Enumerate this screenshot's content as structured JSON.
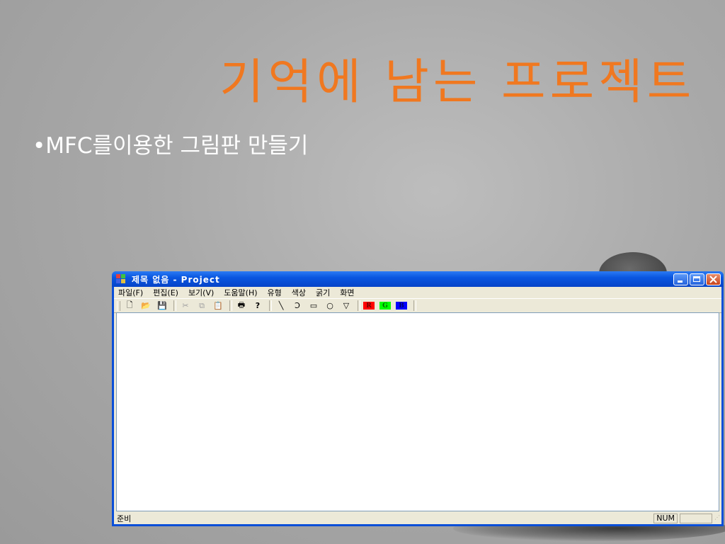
{
  "slide": {
    "title": "기억에 남는 프로젝트",
    "bullet": "•MFC를이용한 그림판 만들기"
  },
  "window": {
    "title": "제목 없음 - Project",
    "controls": {
      "minimize": "_",
      "maximize": "□",
      "close": "×"
    }
  },
  "menu": {
    "items": [
      "파일(F)",
      "편집(E)",
      "보기(V)",
      "도움말(H)",
      "유형",
      "색상",
      "굵기",
      "화면"
    ]
  },
  "toolbar": {
    "buttons": [
      {
        "name": "new-icon",
        "glyph": "🗋"
      },
      {
        "name": "open-icon",
        "glyph": "📂"
      },
      {
        "name": "save-icon",
        "glyph": "💾"
      },
      {
        "name": "cut-icon",
        "glyph": "✂"
      },
      {
        "name": "copy-icon",
        "glyph": "⧉"
      },
      {
        "name": "paste-icon",
        "glyph": "📋"
      },
      {
        "name": "print-icon",
        "glyph": "🖶"
      },
      {
        "name": "help-icon",
        "glyph": "?"
      },
      {
        "name": "line-icon",
        "glyph": "╲"
      },
      {
        "name": "freehand-icon",
        "glyph": "Ɔ"
      },
      {
        "name": "rectangle-icon",
        "glyph": "▭"
      },
      {
        "name": "ellipse-icon",
        "glyph": "○"
      },
      {
        "name": "polygon-icon",
        "glyph": "▽"
      }
    ],
    "colors": [
      {
        "label": "R",
        "color": "#ff0000"
      },
      {
        "label": "G",
        "color": "#00ff00"
      },
      {
        "label": "B",
        "color": "#0000ff"
      }
    ]
  },
  "status": {
    "text": "준비",
    "num": "NUM"
  },
  "colors": {
    "title_orange": "#f07820",
    "xp_blue": "#0a4fd8"
  }
}
